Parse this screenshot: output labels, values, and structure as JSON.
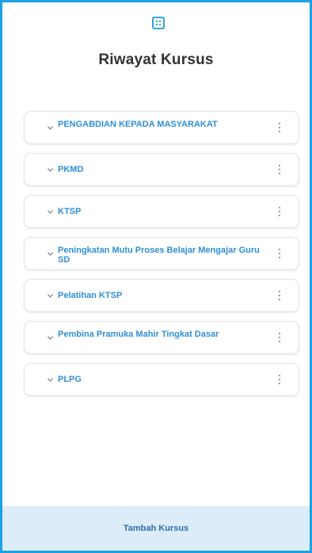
{
  "header": {
    "icon": "grid-apps-icon",
    "title": "Riwayat Kursus"
  },
  "courses": [
    {
      "label": "PENGABDIAN KEPADA MASYARAKAT",
      "two_line": true
    },
    {
      "label": "PKMD",
      "two_line": false
    },
    {
      "label": "KTSP",
      "two_line": false
    },
    {
      "label": "Peningkatan Mutu Proses Belajar Mengajar Guru SD",
      "two_line": true
    },
    {
      "label": "Pelatihan KTSP",
      "two_line": false
    },
    {
      "label": "Pembina Pramuka Mahir Tingkat Dasar",
      "two_line": true
    },
    {
      "label": "PLPG",
      "two_line": false
    }
  ],
  "footer": {
    "add_course_label": "Tambah Kursus"
  },
  "colors": {
    "frame_border": "#1aa1e6",
    "accent_text": "#2e8fd6",
    "footer_bg": "#dcecf8"
  }
}
